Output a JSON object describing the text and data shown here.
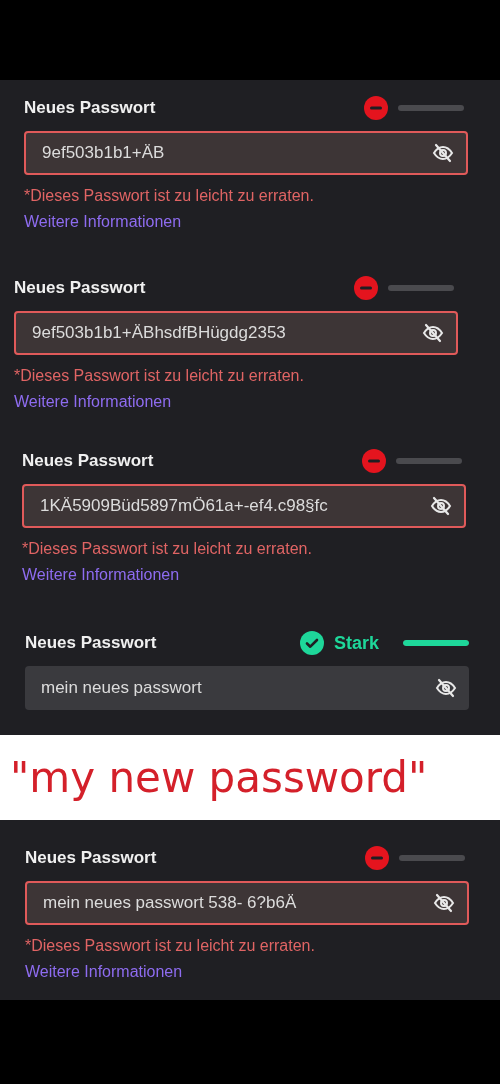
{
  "blocks": [
    {
      "kind": "panel",
      "sections": [
        {
          "label": "Neues Passwort",
          "strength": {
            "kind": "weak",
            "level": 0
          },
          "value": "9ef503b1b1+ÄB",
          "error": true,
          "message": "*Dieses Passwort ist zu leicht zu erraten.",
          "link": "Weitere Informationen"
        },
        {
          "label": "Neues Passwort",
          "strength": {
            "kind": "weak",
            "level": 0
          },
          "value": "9ef503b1b1+ÄBhsdfBHügdg2353",
          "error": true,
          "message": "*Dieses Passwort ist zu leicht zu erraten.",
          "link": "Weitere Informationen"
        },
        {
          "label": "Neues Passwort",
          "strength": {
            "kind": "weak",
            "level": 0
          },
          "value": "1KÄ5909Büd5897mÖ61a+-ef4.c98§fc",
          "error": true,
          "message": "*Dieses Passwort ist zu leicht zu erraten.",
          "link": "Weitere Informationen"
        },
        {
          "label": "Neues Passwort",
          "strength": {
            "kind": "strong",
            "label": "Stark",
            "level": 1
          },
          "value": "mein neues passwort",
          "error": false
        }
      ]
    },
    {
      "kind": "caption",
      "text": "\"my new password\""
    },
    {
      "kind": "panel",
      "sections": [
        {
          "label": "Neues Passwort",
          "strength": {
            "kind": "weak",
            "level": 0
          },
          "value": "mein neues passwort 538- 6?b6Ä",
          "error": true,
          "message": "*Dieses Passwort ist zu leicht zu erraten.",
          "link": "Weitere Informationen"
        }
      ]
    }
  ]
}
